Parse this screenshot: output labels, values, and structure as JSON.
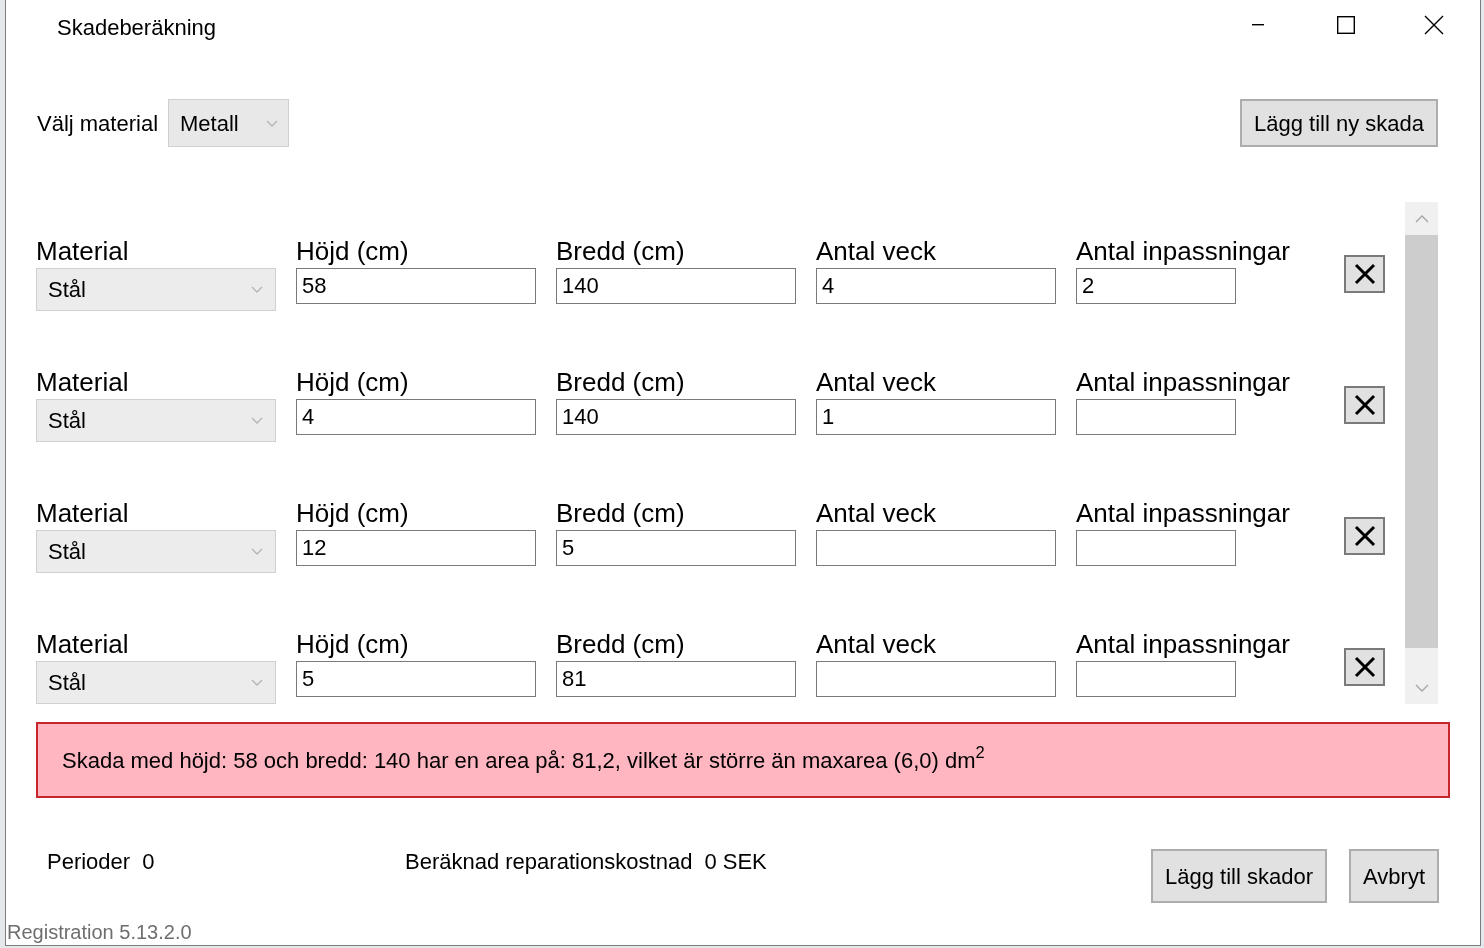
{
  "window": {
    "title": "Skadeberäkning"
  },
  "material_picker": {
    "label": "Välj material",
    "value": "Metall"
  },
  "add_damage_button": {
    "label": "Lägg till ny skada"
  },
  "damages": [
    {
      "fields": [
        {
          "kind": "select",
          "label": "Material",
          "value": "Stål"
        },
        {
          "kind": "text",
          "label": "Höjd (cm)",
          "value": "58"
        },
        {
          "kind": "text",
          "label": "Bredd (cm)",
          "value": "140"
        },
        {
          "kind": "text",
          "label": "Antal veck",
          "value": "4"
        },
        {
          "kind": "text",
          "label": "Antal inpassningar",
          "value": "2"
        }
      ]
    },
    {
      "fields": [
        {
          "kind": "select",
          "label": "Material",
          "value": "Stål"
        },
        {
          "kind": "text",
          "label": "Höjd (cm)",
          "value": "4"
        },
        {
          "kind": "text",
          "label": "Bredd (cm)",
          "value": "140"
        },
        {
          "kind": "text",
          "label": "Antal veck",
          "value": "1"
        },
        {
          "kind": "text",
          "label": "Antal inpassningar"
        }
      ]
    },
    {
      "fields": [
        {
          "kind": "select",
          "label": "Material",
          "value": "Stål"
        },
        {
          "kind": "text",
          "label": "Höjd (cm)",
          "value": "12"
        },
        {
          "kind": "text",
          "label": "Bredd (cm)",
          "value": "5"
        },
        {
          "kind": "text",
          "label": "Antal veck"
        },
        {
          "kind": "text",
          "label": "Antal inpassningar"
        }
      ]
    },
    {
      "fields": [
        {
          "kind": "select",
          "label": "Material",
          "value": "Stål"
        },
        {
          "kind": "text",
          "label": "Höjd (cm)",
          "value": "5"
        },
        {
          "kind": "text",
          "label": "Bredd (cm)",
          "value": "81"
        },
        {
          "kind": "text",
          "label": "Antal veck"
        },
        {
          "kind": "text",
          "label": "Antal inpassningar"
        }
      ]
    }
  ],
  "error_message": "Skada med höjd: 58 och bredd: 140 har en area på: 81,2, vilket är större än maxarea (6,0) dm$^{2}$",
  "summary": {
    "periods_label": "Perioder",
    "periods": "0",
    "cost_label": "Beräknad reparationskostnad",
    "cost": "0 SEK"
  },
  "buttons": [
    {
      "label": "Lägg till skador"
    },
    {
      "label": "Avbryt"
    }
  ],
  "version_label": "Registration 5.13.2.0"
}
